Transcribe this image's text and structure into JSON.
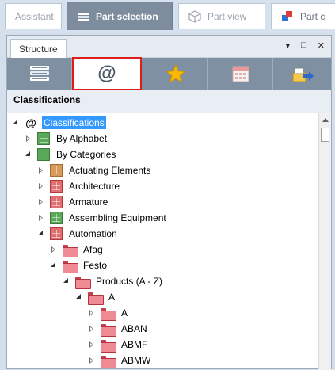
{
  "tabs": [
    {
      "label": "Assistant",
      "active": false
    },
    {
      "label": "Part selection",
      "active": true,
      "icon": "books-icon"
    },
    {
      "label": "Part view",
      "active": false,
      "icon": "cube-icon"
    },
    {
      "label": "Part c",
      "active": false,
      "icon": "part-config-icon"
    }
  ],
  "panel": {
    "tab_label": "Structure",
    "controls": {
      "dropdown": "▾",
      "maximize": "□",
      "close": "✕"
    }
  },
  "toolbar": {
    "buttons": [
      {
        "icon": "books-icon",
        "selected": false
      },
      {
        "icon": "at-sign-icon",
        "label": "@",
        "selected": true
      },
      {
        "icon": "star-icon",
        "selected": false
      },
      {
        "icon": "calendar-icon",
        "selected": false
      },
      {
        "icon": "export-icon",
        "selected": false
      }
    ]
  },
  "section_title": "Classifications",
  "colors": {
    "selection_border": "#e01b1b",
    "highlight": "#3399ff",
    "toolbar_bg": "#7f90a3"
  },
  "tree": [
    {
      "label": "Classifications",
      "state": "expanded",
      "icon": "at-sign-icon",
      "highlight": true
    },
    {
      "label": "By Alphabet",
      "state": "collapsed",
      "icon": "green-grid-icon"
    },
    {
      "label": "By Categories",
      "state": "expanded",
      "icon": "green-grid-icon"
    },
    {
      "label": "Actuating Elements",
      "state": "collapsed",
      "icon": "orange-grid-icon"
    },
    {
      "label": "Architecture",
      "state": "collapsed",
      "icon": "red-grid-icon"
    },
    {
      "label": "Armature",
      "state": "collapsed",
      "icon": "red-grid-icon"
    },
    {
      "label": "Assembling Equipment",
      "state": "collapsed",
      "icon": "green-grid-icon"
    },
    {
      "label": "Automation",
      "state": "expanded",
      "icon": "red-grid-icon"
    },
    {
      "label": "Afag",
      "state": "collapsed",
      "icon": "folder-icon"
    },
    {
      "label": "Festo",
      "state": "expanded",
      "icon": "folder-icon"
    },
    {
      "label": "Products (A - Z)",
      "state": "expanded",
      "icon": "folder-icon"
    },
    {
      "label": "A",
      "state": "expanded",
      "icon": "folder-icon"
    },
    {
      "label": "A",
      "state": "collapsed",
      "icon": "folder-icon"
    },
    {
      "label": "ABAN",
      "state": "collapsed",
      "icon": "folder-icon"
    },
    {
      "label": "ABMF",
      "state": "collapsed",
      "icon": "folder-icon"
    },
    {
      "label": "ABMW",
      "state": "collapsed",
      "icon": "folder-icon"
    }
  ]
}
